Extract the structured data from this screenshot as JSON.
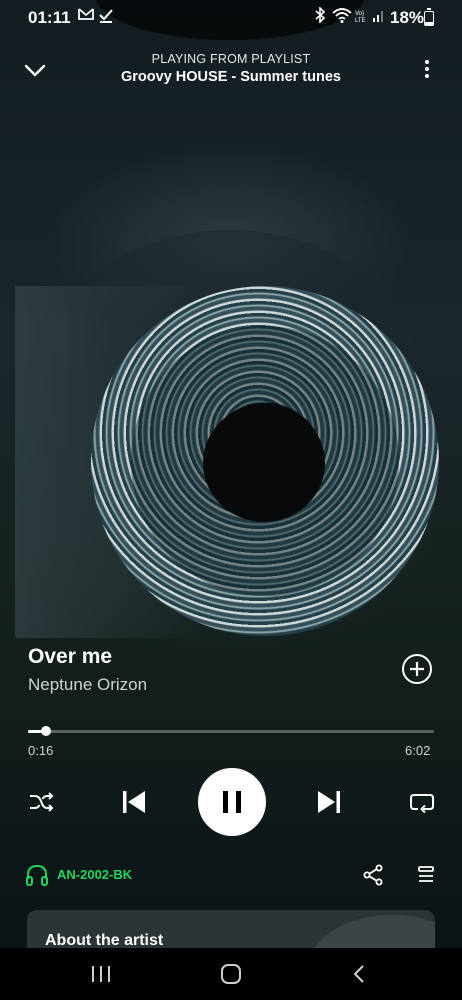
{
  "status_bar": {
    "time": "01:11",
    "battery_percent": "18%"
  },
  "header": {
    "context_label": "PLAYING FROM PLAYLIST",
    "playlist_name": "Groovy HOUSE - Summer tunes"
  },
  "track": {
    "title": "Over me",
    "artist": "Neptune Orizon"
  },
  "progress": {
    "elapsed": "0:16",
    "duration": "6:02",
    "fraction": 0.044
  },
  "device": {
    "name": "AN-2002-BK",
    "color": "#1ed760"
  },
  "about_artist": {
    "label": "About the artist"
  },
  "icons": {
    "collapse": "chevron-down-icon",
    "menu": "more-vertical-icon",
    "add": "add-circle-icon",
    "shuffle": "shuffle-icon",
    "previous": "skip-previous-icon",
    "pause": "pause-icon",
    "next": "skip-next-icon",
    "repeat": "repeat-icon",
    "device": "headphones-icon",
    "share": "share-icon",
    "queue": "queue-icon"
  }
}
